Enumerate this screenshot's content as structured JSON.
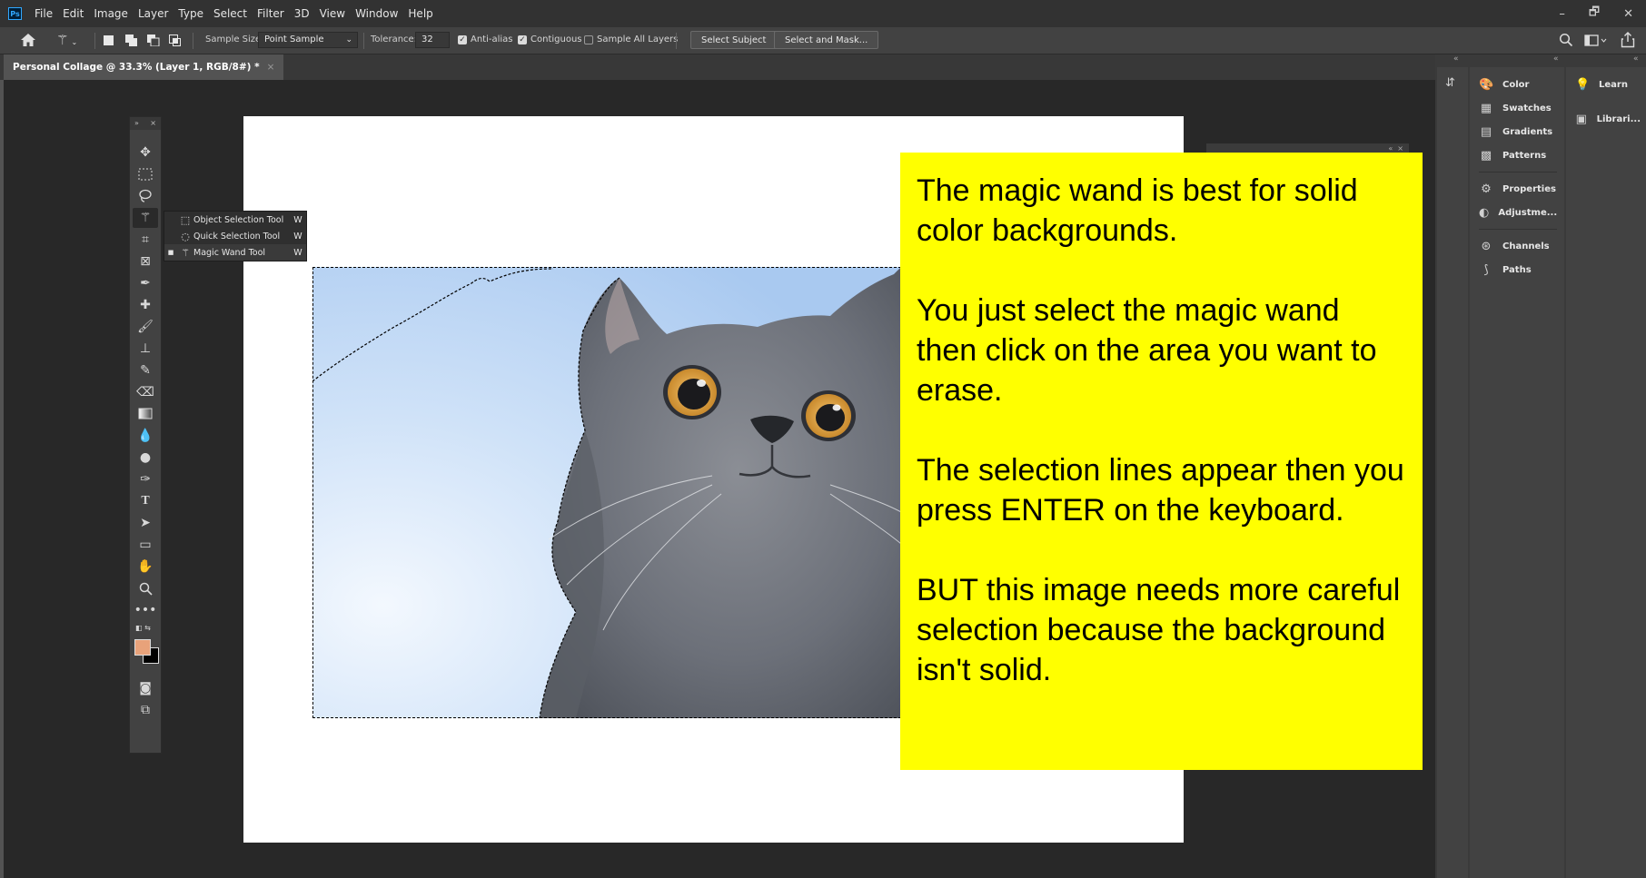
{
  "app": {
    "logo": "Ps"
  },
  "menu": [
    "File",
    "Edit",
    "Image",
    "Layer",
    "Type",
    "Select",
    "Filter",
    "3D",
    "View",
    "Window",
    "Help"
  ],
  "window_controls": {
    "minimize": "–",
    "restore": "🗗",
    "close": "✕"
  },
  "options": {
    "sample_size_label": "Sample Size:",
    "sample_size_value": "Point Sample",
    "tolerance_label": "Tolerance:",
    "tolerance_value": "32",
    "anti_alias": "Anti-alias",
    "contiguous": "Contiguous",
    "sample_all_layers": "Sample All Layers",
    "select_subject": "Select Subject",
    "select_and_mask": "Select and Mask...",
    "checks": {
      "anti_alias": true,
      "contiguous": true,
      "sample_all_layers": false
    }
  },
  "document_tab": {
    "title": "Personal Collage @ 33.3% (Layer 1, RGB/8#) *",
    "close": "×"
  },
  "flyout": {
    "items": [
      {
        "label": "Object Selection Tool",
        "key": "W",
        "selected": false
      },
      {
        "label": "Quick Selection Tool",
        "key": "W",
        "selected": false
      },
      {
        "label": "Magic Wand Tool",
        "key": "W",
        "selected": true
      }
    ]
  },
  "note": {
    "paragraphs": [
      "The magic wand is best for solid color backgrounds.",
      "You just select the magic wand then click on the area you want to erase.",
      "The selection lines appear then you press ENTER on the keyboard.",
      "BUT this image needs more careful selection because the background isn't solid."
    ]
  },
  "panels": {
    "group1": [
      "Color",
      "Swatches",
      "Gradients",
      "Patterns"
    ],
    "group2": [
      "Properties",
      "Adjustme..."
    ],
    "group3": [
      "Channels",
      "Paths"
    ],
    "right": [
      "Learn",
      "Librari..."
    ]
  },
  "colors": {
    "foreground": "#e8a27a",
    "background": "#000000",
    "note_bg": "#ffff00"
  }
}
